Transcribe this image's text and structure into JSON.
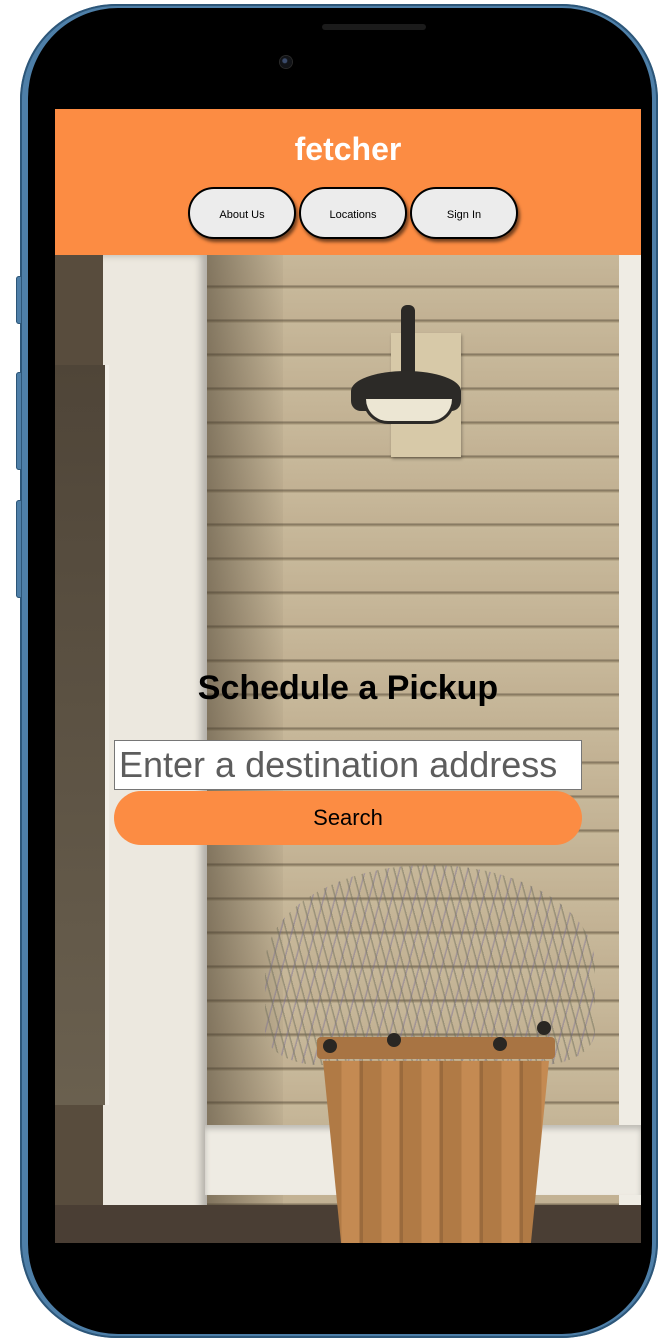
{
  "app": {
    "brand": "fetcher"
  },
  "nav": {
    "items": [
      {
        "label": "About Us"
      },
      {
        "label": "Locations"
      },
      {
        "label": "Sign In"
      }
    ]
  },
  "hero": {
    "title": "Schedule a Pickup",
    "search": {
      "placeholder": "Enter a destination address",
      "value": ""
    },
    "search_button_label": "Search"
  },
  "colors": {
    "accent": "#fc8c43",
    "nav_button_bg": "#ececec",
    "phone_frame": "#4e7fa8"
  }
}
